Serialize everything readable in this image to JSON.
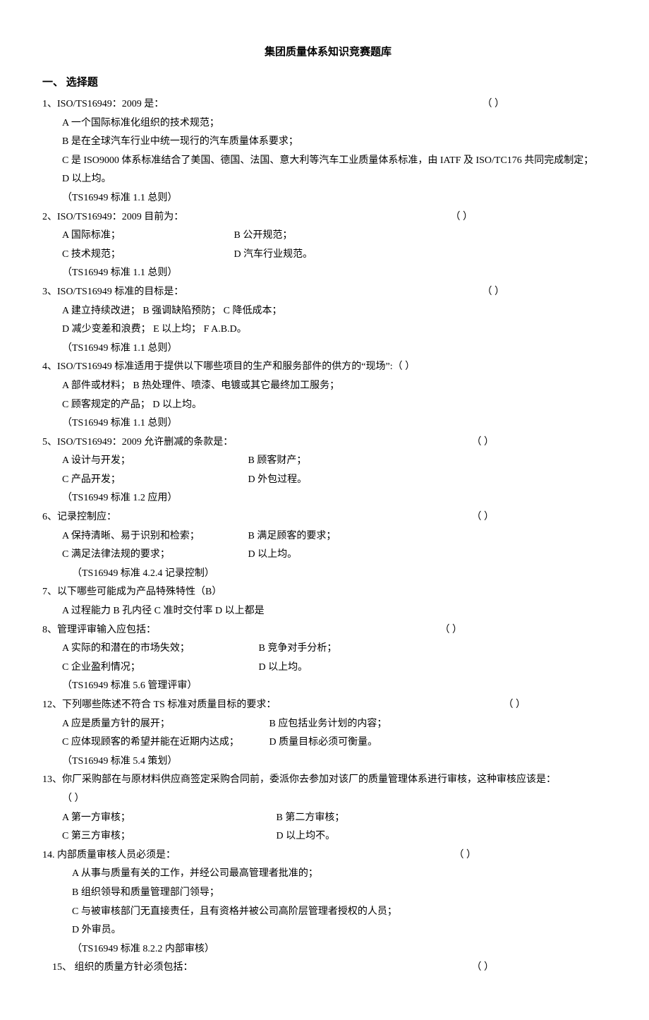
{
  "title": "集团质量体系知识竞赛题库",
  "section1": "一、 选择题",
  "q1": {
    "stem": "1、ISO/TS16949：2009 是：",
    "blank": "（    ）",
    "optA": "A   一个国际标准化组织的技术规范；",
    "optB": "B   是在全球汽车行业中统一现行的汽车质量体系要求；",
    "optC": "C   是 ISO9000 体系标准结合了美国、德国、法国、意大利等汽车工业质量体系标准，由 IATF 及 ISO/TC176 共同完成制定；",
    "optD": "D   以上均。",
    "ref": "（TS16949 标准  1.1 总则）"
  },
  "q2": {
    "stem": "2、ISO/TS16949：2009 目前为：",
    "blank": "（    ）",
    "optA": "A   国际标准；",
    "optB": "B   公开规范；",
    "optC": "C   技术规范；",
    "optD": "D   汽车行业规范。",
    "ref": "（TS16949 标准  1.1 总则）"
  },
  "q3": {
    "stem": "3、ISO/TS16949 标准的目标是：",
    "blank": "（      ）",
    "line1": "A   建立持续改进；      B   强调缺陷预防；      C   降低成本；",
    "line2": "D   减少变差和浪费；    E   以上均；      F   A.B.D。",
    "ref": "（TS16949 标准  1.1 总则）"
  },
  "q4": {
    "stem": "4、ISO/TS16949 标准适用于提供以下哪些项目的生产和服务部件的供方的“现场”:（    ）",
    "line1": "A   部件或材料；        B   热处理件、喷漆、电镀或其它最终加工服务；",
    "line2": "C   顾客规定的产品；    D   以上均。",
    "ref": "（TS16949 标准  1.1 总则）"
  },
  "q5": {
    "stem": "5、ISO/TS16949：2009 允许删减的条款是：",
    "blank": "（    ）",
    "optA": "A   设计与开发；",
    "optB": "B   顾客财产；",
    "optC": "C   产品开发；",
    "optD": "D   外包过程。",
    "ref": "（TS16949 标准  1.2 应用）"
  },
  "q6": {
    "stem": "6、记录控制应：",
    "blank": "（    ）",
    "optA": "A   保持清晰、易于识别和检索；",
    "optB": "B   满足顾客的要求；",
    "optC": "C   满足法律法规的要求；",
    "optD": "D   以上均。",
    "ref": "（TS16949 标准  4.2.4 记录控制）"
  },
  "q7": {
    "stem": "7、以下哪些可能成为产品特殊特性（B）",
    "opts": "A 过程能力 B 孔内径 C 准时交付率  D 以上都是"
  },
  "q8": {
    "stem": "8、管理评审输入应包括：",
    "blank": "（    ）",
    "optA": "A   实际的和潜在的市场失效；",
    "optB": "B   竞争对手分析；",
    "optC": "C   企业盈利情况；",
    "optD": "D   以上均。",
    "ref": "（TS16949 标准  5.6 管理评审）"
  },
  "q12": {
    "stem": "12、下列哪些陈述不符合 TS 标准对质量目标的要求：",
    "blank": "（    ）",
    "optA": "A   应是质量方针的展开；",
    "optB": "B   应包括业务计划的内容；",
    "optC": "C   应体现顾客的希望并能在近期内达成；",
    "optD": "D   质量目标必须可衡量。",
    "ref": "（TS16949 标准  5.4 策划）"
  },
  "q13": {
    "stem": "13、你厂采购部在与原材料供应商签定采购合同前，委派你去参加对该厂的质量管理体系进行审核，这种审核应该是：",
    "blank": "（    ）",
    "optA": "A   第一方审核；",
    "optB": "B   第二方审核；",
    "optC": "C   第三方审核；",
    "optD": "D   以上均不。"
  },
  "q14": {
    "stem": "14.   内部质量审核人员必须是：",
    "blank": "（    ）",
    "optA": "A   从事与质量有关的工作，并经公司最高管理者批准的；",
    "optB": "B   组织领导和质量管理部门领导；",
    "optC": "C   与被审核部门无直接责任，且有资格并被公司高阶层管理者授权的人员；",
    "optD": "D   外审员。",
    "ref": "（TS16949 标准  8.2.2 内部审核）"
  },
  "q15": {
    "stem": "15、 组织的质量方针必须包括：",
    "blank": "（    ）"
  }
}
